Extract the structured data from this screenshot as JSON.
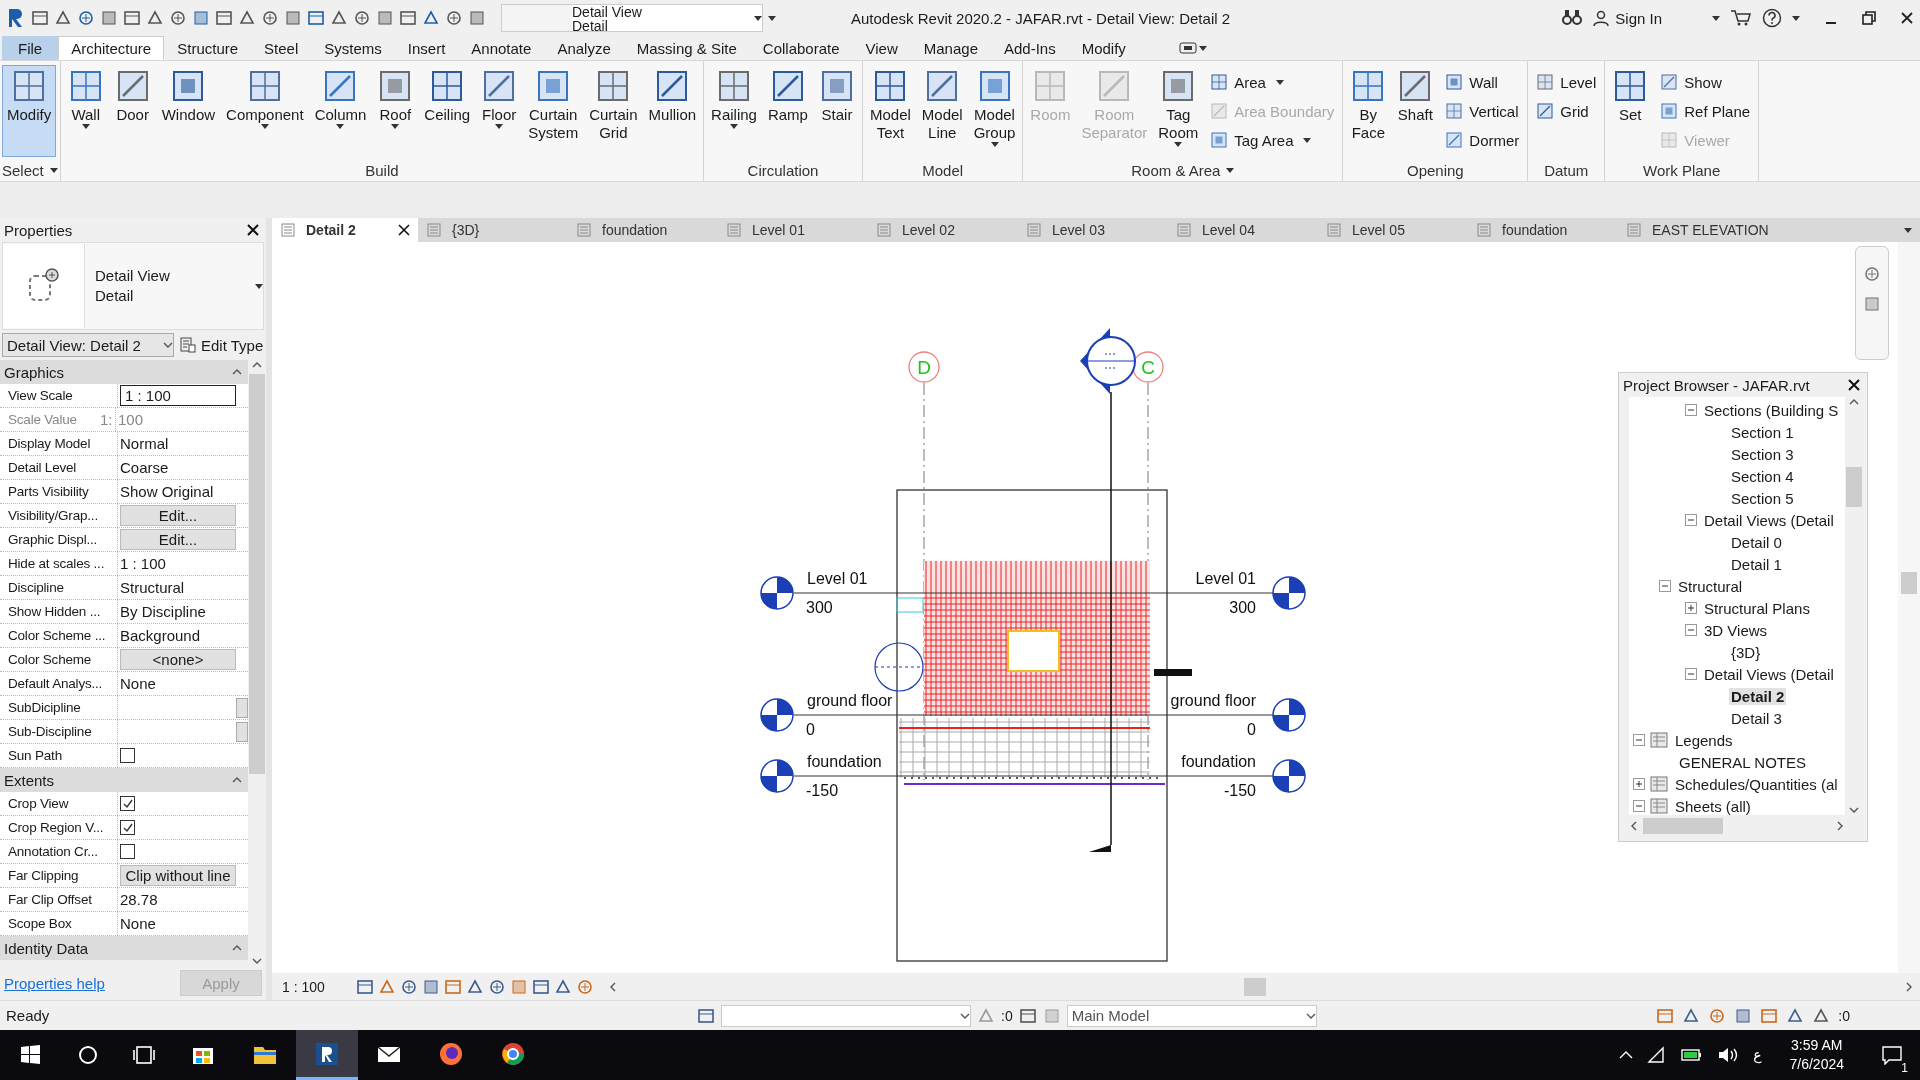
{
  "title_bar": {
    "view_type_line1": "Detail View",
    "view_type_line2": "Detail",
    "title": "Autodesk Revit 2020.2 - JAFAR.rvt - Detail View: Detail 2",
    "sign_in": "Sign In"
  },
  "menu_tabs": [
    {
      "label": "File",
      "kind": "file",
      "selected": false
    },
    {
      "label": "Architecture",
      "kind": "tab",
      "selected": true
    },
    {
      "label": "Structure",
      "kind": "tab",
      "selected": false
    },
    {
      "label": "Steel",
      "kind": "tab",
      "selected": false
    },
    {
      "label": "Systems",
      "kind": "tab",
      "selected": false
    },
    {
      "label": "Insert",
      "kind": "tab",
      "selected": false
    },
    {
      "label": "Annotate",
      "kind": "tab",
      "selected": false
    },
    {
      "label": "Analyze",
      "kind": "tab",
      "selected": false
    },
    {
      "label": "Massing & Site",
      "kind": "tab",
      "selected": false
    },
    {
      "label": "Collaborate",
      "kind": "tab",
      "selected": false
    },
    {
      "label": "View",
      "kind": "tab",
      "selected": false
    },
    {
      "label": "Manage",
      "kind": "tab",
      "selected": false
    },
    {
      "label": "Add-Ins",
      "kind": "tab",
      "selected": false
    },
    {
      "label": "Modify",
      "kind": "tab",
      "selected": false
    }
  ],
  "ribbon_panels": [
    {
      "title": "Select",
      "title_menu": true,
      "tools": [
        {
          "label": "Modify",
          "kind": "large",
          "selected": true,
          "disabled": false,
          "menu": false
        }
      ]
    },
    {
      "title": "Build",
      "tools": [
        {
          "label": "Wall",
          "kind": "large",
          "selected": false,
          "disabled": false,
          "menu": true
        },
        {
          "label": "Door",
          "kind": "large",
          "selected": false,
          "disabled": false,
          "menu": false
        },
        {
          "label": "Window",
          "kind": "large",
          "selected": false,
          "disabled": false,
          "menu": false
        },
        {
          "label": "Component",
          "kind": "large",
          "selected": false,
          "disabled": false,
          "menu": true
        },
        {
          "label": "Column",
          "kind": "large",
          "selected": false,
          "disabled": false,
          "menu": true
        },
        {
          "label": "Roof",
          "kind": "large",
          "selected": false,
          "disabled": false,
          "menu": true
        },
        {
          "label": "Ceiling",
          "kind": "large",
          "selected": false,
          "disabled": false,
          "menu": false
        },
        {
          "label": "Floor",
          "kind": "large",
          "selected": false,
          "disabled": false,
          "menu": true
        },
        {
          "label": "Curtain System",
          "kind": "large",
          "selected": false,
          "disabled": false,
          "menu": false
        },
        {
          "label": "Curtain Grid",
          "kind": "large",
          "selected": false,
          "disabled": false,
          "menu": false
        },
        {
          "label": "Mullion",
          "kind": "large",
          "selected": false,
          "disabled": false,
          "menu": false
        }
      ]
    },
    {
      "title": "Circulation",
      "tools": [
        {
          "label": "Railing",
          "kind": "large",
          "selected": false,
          "disabled": false,
          "menu": true
        },
        {
          "label": "Ramp",
          "kind": "large",
          "selected": false,
          "disabled": false,
          "menu": false
        },
        {
          "label": "Stair",
          "kind": "large",
          "selected": false,
          "disabled": false,
          "menu": false
        }
      ]
    },
    {
      "title": "Model",
      "tools": [
        {
          "label": "Model Text",
          "kind": "large",
          "selected": false,
          "disabled": false,
          "menu": false
        },
        {
          "label": "Model Line",
          "kind": "large",
          "selected": false,
          "disabled": false,
          "menu": false
        },
        {
          "label": "Model Group",
          "kind": "large",
          "selected": false,
          "disabled": false,
          "menu": true
        }
      ]
    },
    {
      "title": "Room & Area",
      "title_menu": true,
      "tools": [
        {
          "label": "Room",
          "kind": "large",
          "selected": false,
          "disabled": true,
          "menu": false
        },
        {
          "label": "Room Separator",
          "kind": "large",
          "selected": false,
          "disabled": true,
          "menu": false
        },
        {
          "label": "Tag Room",
          "kind": "large",
          "selected": false,
          "disabled": false,
          "menu": true
        },
        {
          "label": "Area",
          "kind": "small",
          "selected": false,
          "disabled": false,
          "menu": true
        },
        {
          "label": "Area Boundary",
          "kind": "small",
          "selected": false,
          "disabled": true,
          "menu": false
        },
        {
          "label": "Tag Area",
          "kind": "small",
          "selected": false,
          "disabled": false,
          "menu": true
        }
      ]
    },
    {
      "title": "Opening",
      "tools": [
        {
          "label": "By Face",
          "kind": "large",
          "selected": false,
          "disabled": false,
          "menu": false
        },
        {
          "label": "Shaft",
          "kind": "large",
          "selected": false,
          "disabled": false,
          "menu": false
        },
        {
          "label": "Wall",
          "kind": "small",
          "selected": false,
          "disabled": false,
          "menu": false
        },
        {
          "label": "Vertical",
          "kind": "small",
          "selected": false,
          "disabled": false,
          "menu": false
        },
        {
          "label": "Dormer",
          "kind": "small",
          "selected": false,
          "disabled": false,
          "menu": false
        }
      ]
    },
    {
      "title": "Datum",
      "tools": [
        {
          "label": "Level",
          "kind": "small",
          "selected": false,
          "disabled": false,
          "menu": false
        },
        {
          "label": "Grid",
          "kind": "small",
          "selected": false,
          "disabled": false,
          "menu": false
        }
      ]
    },
    {
      "title": "Work Plane",
      "tools": [
        {
          "label": "Set",
          "kind": "large",
          "selected": false,
          "disabled": false,
          "menu": false
        },
        {
          "label": "Show",
          "kind": "small",
          "selected": false,
          "disabled": false,
          "menu": false
        },
        {
          "label": "Ref Plane",
          "kind": "small",
          "selected": false,
          "disabled": false,
          "menu": false
        },
        {
          "label": "Viewer",
          "kind": "small",
          "selected": false,
          "disabled": true,
          "menu": false
        }
      ]
    }
  ],
  "properties": {
    "title": "Properties",
    "type_line1": "Detail View",
    "type_line2": "Detail",
    "instance": "Detail View: Detail 2",
    "edit_type": "Edit Type",
    "groups": [
      {
        "title": "Graphics",
        "rows": [
          {
            "label": "View Scale",
            "value": "1 : 100",
            "kind": "field"
          },
          {
            "label": "Scale Value",
            "prefix": "1:",
            "value": "100",
            "kind": "readonly"
          },
          {
            "label": "Display Model",
            "value": "Normal",
            "kind": "text"
          },
          {
            "label": "Detail Level",
            "value": "Coarse",
            "kind": "text"
          },
          {
            "label": "Parts Visibility",
            "value": "Show Original",
            "kind": "text"
          },
          {
            "label": "Visibility/Grap...",
            "value": "Edit...",
            "kind": "button"
          },
          {
            "label": "Graphic Displ...",
            "value": "Edit...",
            "kind": "button"
          },
          {
            "label": "Hide at scales ...",
            "value": "1 : 100",
            "kind": "text"
          },
          {
            "label": "Discipline",
            "value": "Structural",
            "kind": "text"
          },
          {
            "label": "Show Hidden ...",
            "value": "By Discipline",
            "kind": "text"
          },
          {
            "label": "Color Scheme ...",
            "value": "Background",
            "kind": "text"
          },
          {
            "label": "Color Scheme",
            "value": "<none>",
            "kind": "button"
          },
          {
            "label": "Default Analys...",
            "value": "None",
            "kind": "text"
          },
          {
            "label": "SubDicipline",
            "kind": "blank"
          },
          {
            "label": "Sub-Discipline",
            "kind": "blank"
          },
          {
            "label": "Sun Path",
            "kind": "checkbox",
            "checked": false
          }
        ]
      },
      {
        "title": "Extents",
        "rows": [
          {
            "label": "Crop View",
            "kind": "checkbox",
            "checked": true
          },
          {
            "label": "Crop Region V...",
            "kind": "checkbox",
            "checked": true
          },
          {
            "label": "Annotation Cr...",
            "kind": "checkbox",
            "checked": false
          },
          {
            "label": "Far Clipping",
            "value": "Clip without line",
            "kind": "button"
          },
          {
            "label": "Far Clip Offset",
            "value": "28.78",
            "kind": "text"
          },
          {
            "label": "Scope Box",
            "value": "None",
            "kind": "text"
          }
        ]
      },
      {
        "title": "Identity Data"
      }
    ],
    "help_link": "Properties help",
    "apply": "Apply"
  },
  "view_tabs": [
    {
      "label": "Detail 2",
      "selected": true,
      "closable": true
    },
    {
      "label": "{3D}",
      "selected": false,
      "closable": false
    },
    {
      "label": "foundation",
      "selected": false,
      "closable": false
    },
    {
      "label": "Level 01",
      "selected": false,
      "closable": false
    },
    {
      "label": "Level 02",
      "selected": false,
      "closable": false
    },
    {
      "label": "Level 03",
      "selected": false,
      "closable": false
    },
    {
      "label": "Level 04",
      "selected": false,
      "closable": false
    },
    {
      "label": "Level 05",
      "selected": false,
      "closable": false
    },
    {
      "label": "foundation",
      "selected": false,
      "closable": false
    },
    {
      "label": "EAST ELEVATION",
      "selected": false,
      "closable": false
    }
  ],
  "drawing": {
    "grids": [
      {
        "label": "D"
      },
      {
        "label": "C"
      }
    ],
    "levels": [
      {
        "left": {
          "name": "Level 01",
          "elevation": "300"
        },
        "right": {
          "name": "Level 01",
          "elevation": "300"
        }
      },
      {
        "left": {
          "name": "ground floor",
          "elevation": "0"
        },
        "right": {
          "name": "ground floor",
          "elevation": "0"
        }
      },
      {
        "left": {
          "name": "foundation",
          "elevation": "-150"
        },
        "right": {
          "name": "foundation",
          "elevation": "-150"
        }
      }
    ]
  },
  "project_browser": {
    "title": "Project Browser - JAFAR.rvt",
    "tree": [
      {
        "children": [
          {
            "children": [
              {
                "label": "Sections (Building S",
                "expanded": true,
                "selected": false,
                "children": [
                  {
                    "label": "Section 1",
                    "selected": false
                  },
                  {
                    "label": "Section 3",
                    "selected": false
                  },
                  {
                    "label": "Section 4",
                    "selected": false
                  },
                  {
                    "label": "Section 5",
                    "selected": false
                  }
                ]
              },
              {
                "label": "Detail Views (Detail",
                "expanded": true,
                "selected": false,
                "children": [
                  {
                    "label": "Detail 0",
                    "selected": false
                  },
                  {
                    "label": "Detail 1",
                    "selected": false
                  }
                ]
              }
            ]
          },
          {
            "label": "Structural",
            "expanded": true,
            "selected": false,
            "children": [
              {
                "label": "Structural Plans",
                "expanded": false,
                "selected": false
              },
              {
                "label": "3D Views",
                "expanded": true,
                "selected": false,
                "children": [
                  {
                    "label": "{3D}",
                    "selected": false
                  }
                ]
              },
              {
                "label": "Detail Views (Detail",
                "expanded": true,
                "selected": false,
                "children": [
                  {
                    "label": "Detail 2",
                    "selected": true
                  },
                  {
                    "label": "Detail 3",
                    "selected": false
                  }
                ]
              }
            ]
          }
        ]
      },
      {
        "label": "Legends",
        "expanded": true,
        "selected": false,
        "children": [
          {
            "label": "GENERAL NOTES",
            "selected": false
          }
        ]
      },
      {
        "label": "Schedules/Quantities (al",
        "expanded": false,
        "selected": false
      },
      {
        "label": "Sheets (all)",
        "expanded": true,
        "selected": false
      }
    ]
  },
  "view_bar": {
    "scale": "1 : 100"
  },
  "status_bar": {
    "message": "Ready",
    "selection_count": ":0",
    "model": "Main Model",
    "filter_count": ":0"
  },
  "taskbar": {
    "apps": [
      {
        "selected": false
      },
      {
        "selected": false
      },
      {
        "selected": true
      },
      {
        "selected": false
      },
      {
        "selected": false
      },
      {
        "selected": false
      }
    ],
    "language": "ع",
    "time": "3:59 AM",
    "date": "7/6/2024",
    "notifications": "1"
  }
}
